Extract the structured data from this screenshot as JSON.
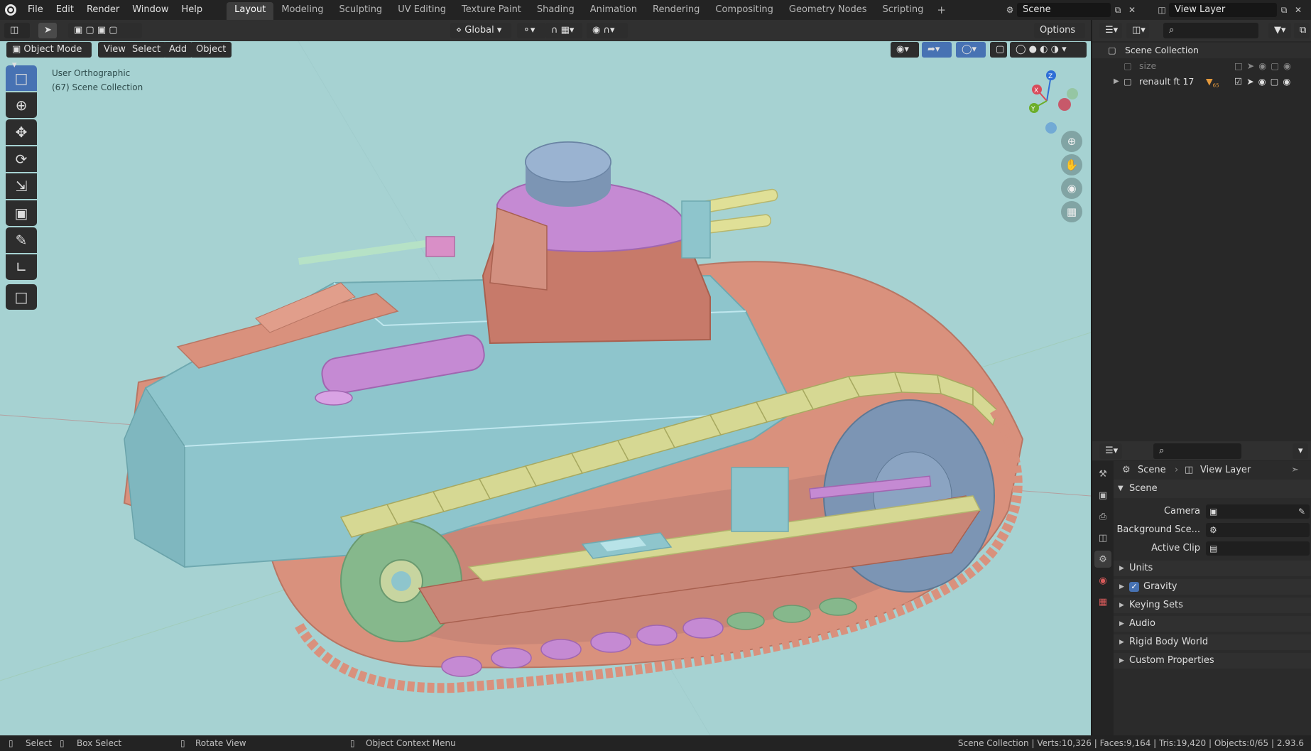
{
  "menu": [
    "File",
    "Edit",
    "Render",
    "Window",
    "Help"
  ],
  "workspaces": [
    "Layout",
    "Modeling",
    "Sculpting",
    "UV Editing",
    "Texture Paint",
    "Shading",
    "Animation",
    "Rendering",
    "Compositing",
    "Geometry Nodes",
    "Scripting"
  ],
  "active_workspace": "Layout",
  "add_workspace": "+",
  "scene_name": "Scene",
  "view_layer_name": "View Layer",
  "header": {
    "mode": "Object Mode",
    "view": "View",
    "select": "Select",
    "add": "Add",
    "object": "Object",
    "orientation": "Global",
    "options": "Options"
  },
  "viewport": {
    "view_name": "User Orthographic",
    "collection_info": "(67) Scene Collection"
  },
  "gizmo_axes": {
    "x": "X",
    "y": "Y",
    "z": "Z"
  },
  "outliner": {
    "root": "Scene Collection",
    "items": [
      {
        "name": "size"
      },
      {
        "name": "renault ft 17",
        "badge": "65"
      }
    ]
  },
  "properties": {
    "scene_tab": "Scene",
    "view_layer_tab": "View Layer",
    "panel_title": "Scene",
    "camera_label": "Camera",
    "background_label": "Background Sce...",
    "active_clip_label": "Active Clip",
    "sections": [
      "Units",
      "Gravity",
      "Keying Sets",
      "Audio",
      "Rigid Body World",
      "Custom Properties"
    ]
  },
  "status": {
    "select": "Select",
    "box_select": "Box Select",
    "rotate_view": "Rotate View",
    "context_menu": "Object Context Menu",
    "stats": "Scene Collection | Verts:10,326 | Faces:9,164 | Tris:19,420 | Objects:0/65 | 2.93.6"
  },
  "colors": {
    "viewport_bg": "#a6d2d2",
    "accent": "#4772b3",
    "hull": "#8ec5cc",
    "track": "#d9917d",
    "track_plate": "#d6d893",
    "turret": "#c77a6a",
    "turret_top": "#c58ad3",
    "cupola": "#7c95b4",
    "wheel_green": "#86b88c"
  }
}
